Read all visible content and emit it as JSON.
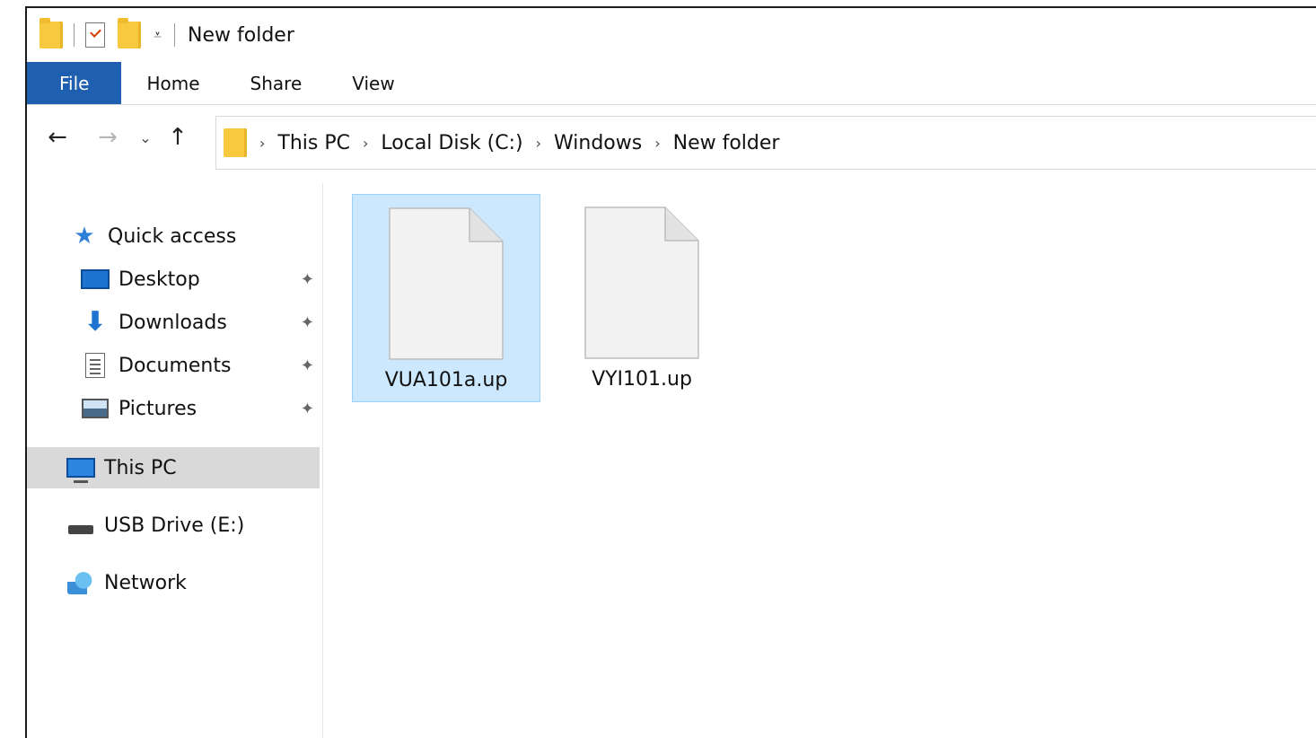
{
  "window": {
    "title": "New folder"
  },
  "quick_access_toolbar": {
    "icons": [
      "folder-icon",
      "properties-check-icon",
      "new-folder-icon",
      "customize-dropdown-icon"
    ],
    "dropdown_glyph": "⩡"
  },
  "ribbon": {
    "tabs": [
      {
        "label": "File",
        "active": true
      },
      {
        "label": "Home"
      },
      {
        "label": "Share"
      },
      {
        "label": "View"
      }
    ],
    "accent_color": "#1e5fb0"
  },
  "navigation_buttons": {
    "back": "←",
    "forward": "→",
    "recent": "⌄",
    "up": "↑"
  },
  "address_bar": {
    "separator": "›",
    "crumbs": [
      "This PC",
      "Local Disk (C:)",
      "Windows",
      "New folder"
    ]
  },
  "nav_pane": {
    "quick_access": {
      "label": "Quick access",
      "icon": "star-icon"
    },
    "pinned": [
      {
        "label": "Desktop",
        "icon": "desktop-icon"
      },
      {
        "label": "Downloads",
        "icon": "download-arrow-icon"
      },
      {
        "label": "Documents",
        "icon": "document-icon"
      },
      {
        "label": "Pictures",
        "icon": "pictures-icon"
      }
    ],
    "pin_glyph": "📌",
    "this_pc": {
      "label": "This PC",
      "selected": true,
      "icon": "computer-icon"
    },
    "usb": {
      "label": "USB Drive (E:)",
      "icon": "usb-drive-icon"
    },
    "network": {
      "label": "Network",
      "icon": "network-icon"
    }
  },
  "files": [
    {
      "name": "VUA101a.up",
      "selected": true,
      "icon": "blank-file-icon"
    },
    {
      "name": "VYI101.up",
      "selected": false,
      "icon": "blank-file-icon"
    }
  ],
  "selection_color": "#cce8ff"
}
